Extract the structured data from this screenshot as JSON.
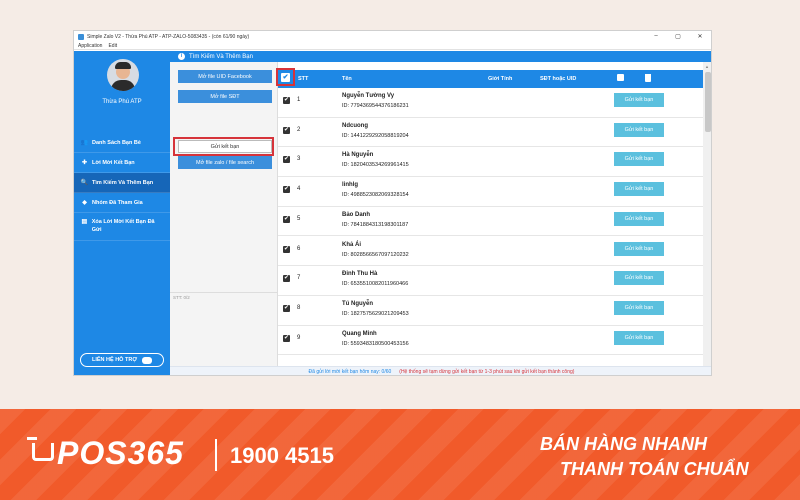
{
  "window": {
    "title": "Simple Zalo V2 - Thừa Phú ATP - ATP-ZALO-5083435 - (còn 61/90 ngày)",
    "menu": [
      "Application",
      "Edit"
    ]
  },
  "controls": {
    "minimize": "–",
    "maximize": "▢",
    "close": "✕"
  },
  "sidebar": {
    "user_name": "Thừa Phú ATP",
    "items": [
      {
        "label": "Danh Sách Bạn Bè",
        "icon": "users-icon",
        "glyph": "👥",
        "active": false
      },
      {
        "label": "Lời Mời Kết Bạn",
        "icon": "plus-icon",
        "glyph": "✚",
        "active": false
      },
      {
        "label": "Tìm Kiếm Và Thêm Bạn",
        "icon": "search-icon",
        "glyph": "🔍",
        "active": true
      },
      {
        "label": "Nhóm Đã Tham Gia",
        "icon": "layers-icon",
        "glyph": "◆",
        "active": false
      },
      {
        "label": "Xóa Lời Mời Kết Bạn Đã Gửi",
        "icon": "document-icon",
        "glyph": "▤",
        "active": false
      }
    ],
    "contact_label": "LIÊN HỆ HỖ TRỢ"
  },
  "header": {
    "info_glyph": "i",
    "title": "Tìm Kiếm Và Thêm Bạn"
  },
  "actions": {
    "open_uid_facebook": "Mở file UID Facebook",
    "open_phone": "Mở file SĐT",
    "send_request": "Gửi kết bạn",
    "open_zalo_search": "Mở file zalo / file search",
    "log_label": "STT: 0/2"
  },
  "table": {
    "header_check_glyph": "✔",
    "columns": {
      "stt": "STT",
      "name": "Tên",
      "gender": "Giới Tính",
      "phone_uid": "SĐT hoặc UID"
    },
    "row_check_glyph": "✔",
    "row_button_label": "Gửi kết bạn",
    "rows": [
      {
        "stt": "1",
        "name": "Nguyễn Tường Vy",
        "uid": "ID: 7794369544376186231"
      },
      {
        "stt": "2",
        "name": "Ndcuong",
        "uid": "ID: 1441229292058819204"
      },
      {
        "stt": "3",
        "name": "Hà Nguyễn",
        "uid": "ID: 1820403534269961415"
      },
      {
        "stt": "4",
        "name": "linhlg",
        "uid": "ID: 4988523082069328154"
      },
      {
        "stt": "5",
        "name": "Bảo Danh",
        "uid": "ID: 7841884313198301187"
      },
      {
        "stt": "6",
        "name": "Khả Ái",
        "uid": "ID: 8028566567097120232"
      },
      {
        "stt": "7",
        "name": "Đinh Thu Hà",
        "uid": "ID: 6535510082011960466"
      },
      {
        "stt": "8",
        "name": "Tú Nguyễn",
        "uid": "ID: 1827575629021209453"
      },
      {
        "stt": "9",
        "name": "Quang Minh",
        "uid": "ID: 5593483180500453156"
      }
    ]
  },
  "scroll": {
    "up_glyph": "▲"
  },
  "status": {
    "sent_count": "Đã gửi lời mời kết bạn hôm nay: 0/60",
    "notice": "(Hệ thống sẽ tạm dừng gửi kết bạn từ 1-3 phút sau khi gửi kết bạn thành công)"
  },
  "footer": {
    "logo_text": "POS365",
    "phone": "1900 4515",
    "slogan_1": "BÁN HÀNG NHANH",
    "slogan_2": "THANH TOÁN CHUẨN"
  }
}
